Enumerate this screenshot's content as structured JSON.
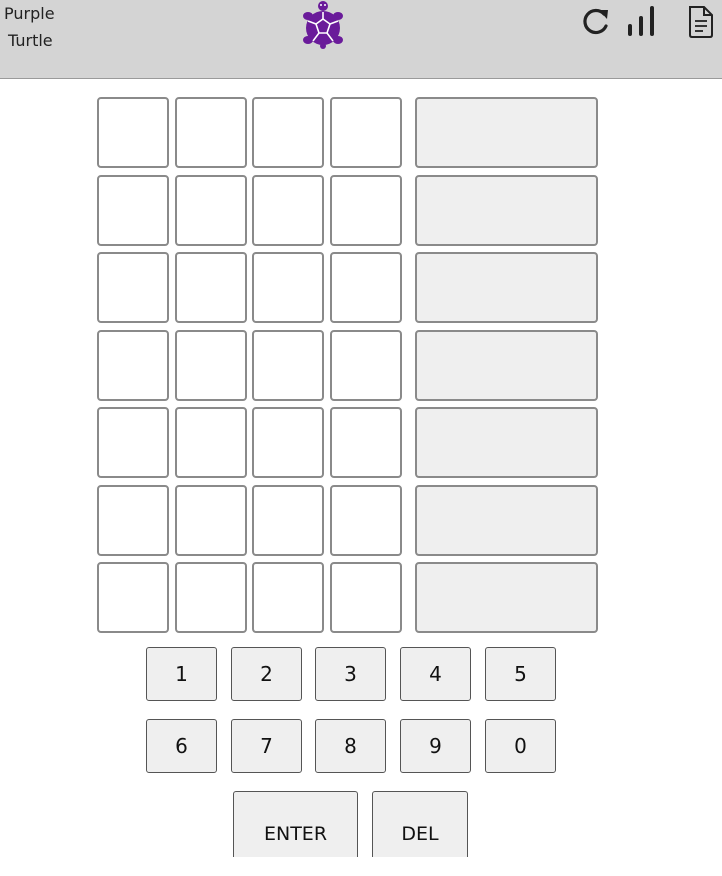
{
  "header": {
    "brand_line1": "Purple",
    "brand_line2": "Turtle",
    "logo_icon": "turtle-logo-icon",
    "refresh_icon": "refresh-icon",
    "stats_icon": "bar-chart-icon",
    "rules_icon": "document-icon",
    "logo_color": "#6a1b9a",
    "header_bg": "#d4d4d4"
  },
  "board": {
    "rows": [
      {
        "cells": [
          "",
          "",
          "",
          ""
        ],
        "result": ""
      },
      {
        "cells": [
          "",
          "",
          "",
          ""
        ],
        "result": ""
      },
      {
        "cells": [
          "",
          "",
          "",
          ""
        ],
        "result": ""
      },
      {
        "cells": [
          "",
          "",
          "",
          ""
        ],
        "result": ""
      },
      {
        "cells": [
          "",
          "",
          "",
          ""
        ],
        "result": ""
      },
      {
        "cells": [
          "",
          "",
          "",
          ""
        ],
        "result": ""
      },
      {
        "cells": [
          "",
          "",
          "",
          ""
        ],
        "result": ""
      }
    ]
  },
  "keypad": {
    "row1": [
      "1",
      "2",
      "3",
      "4",
      "5"
    ],
    "row2": [
      "6",
      "7",
      "8",
      "9",
      "0"
    ],
    "enter_label": "ENTER",
    "del_label": "DEL"
  }
}
